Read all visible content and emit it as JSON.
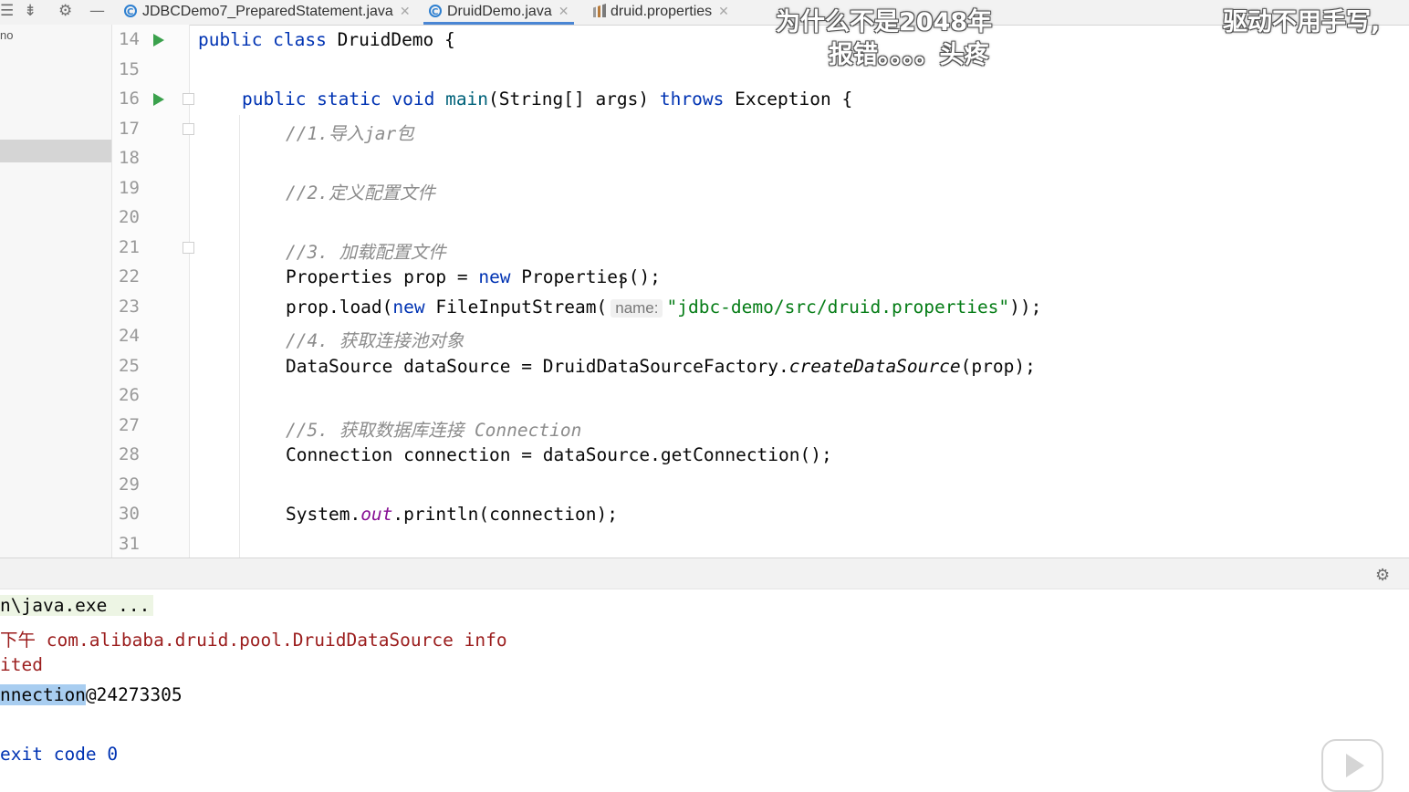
{
  "toolbar": {
    "icons": [
      "list-icon",
      "collapse-icon",
      "gear-icon",
      "minimize-icon"
    ],
    "glyphs": [
      "☰",
      "⇟",
      "⚙",
      "—"
    ]
  },
  "tabs": [
    {
      "label": "JDBCDemo7_PreparedStatement.java",
      "icon": "java-class-icon",
      "active": false
    },
    {
      "label": "DruidDemo.java",
      "icon": "java-class-icon",
      "active": true
    },
    {
      "label": "druid.properties",
      "icon": "properties-file-icon",
      "active": false
    }
  ],
  "left_panel": {
    "text": "no"
  },
  "editor": {
    "line_numbers": [
      "14",
      "15",
      "16",
      "17",
      "18",
      "19",
      "20",
      "21",
      "22",
      "23",
      "24",
      "25",
      "26",
      "27",
      "28",
      "29",
      "30",
      "31"
    ],
    "lines": {
      "l14": {
        "kw1": "public class",
        "text": " DruidDemo {"
      },
      "l16": {
        "kw1": "public static void",
        "fn": "main",
        "mid": "(String[] args) ",
        "kw2": "throws",
        "end": " Exception {"
      },
      "l17": {
        "comment": "//1.导入jar包"
      },
      "l19": {
        "comment": "//2.定义配置文件"
      },
      "l21": {
        "comment": "//3. 加载配置文件"
      },
      "l22": {
        "a": "Properties prop = ",
        "kw": "new",
        "b": " Properties();"
      },
      "l23": {
        "a": "prop.load(",
        "kw": "new",
        "b": " FileInputStream(",
        "hint": "name:",
        "str": "\"jdbc-demo/src/druid.properties\"",
        "c": "));"
      },
      "l24": {
        "comment": "//4. 获取连接池对象"
      },
      "l25": {
        "a": "DataSource dataSource = DruidDataSourceFactory.",
        "it": "createDataSource",
        "b": "(prop);"
      },
      "l27": {
        "comment": "//5. 获取数据库连接 Connection"
      },
      "l28": {
        "text": "Connection connection = dataSource.getConnection();"
      },
      "l30": {
        "a": "System.",
        "field": "out",
        "b": ".println(connection);"
      }
    }
  },
  "overlays": {
    "top1": "为什么不是2048年",
    "top2": "报错。。。。头疼",
    "top3": "驱动不用手写,"
  },
  "console": {
    "line1": "n\\java.exe ...",
    "line2a": "下午 ",
    "line2b": "com.alibaba.druid.pool.DruidDataSource info",
    "line3": "ited",
    "line4a": "nnection",
    "line4b": "@24273305",
    "line5": "exit code 0"
  },
  "colors": {
    "keyword": "#0033b3",
    "string": "#067d17",
    "comment": "#8c8c8c",
    "run_green": "#3aa14c",
    "console_red": "#9b1d1d"
  }
}
